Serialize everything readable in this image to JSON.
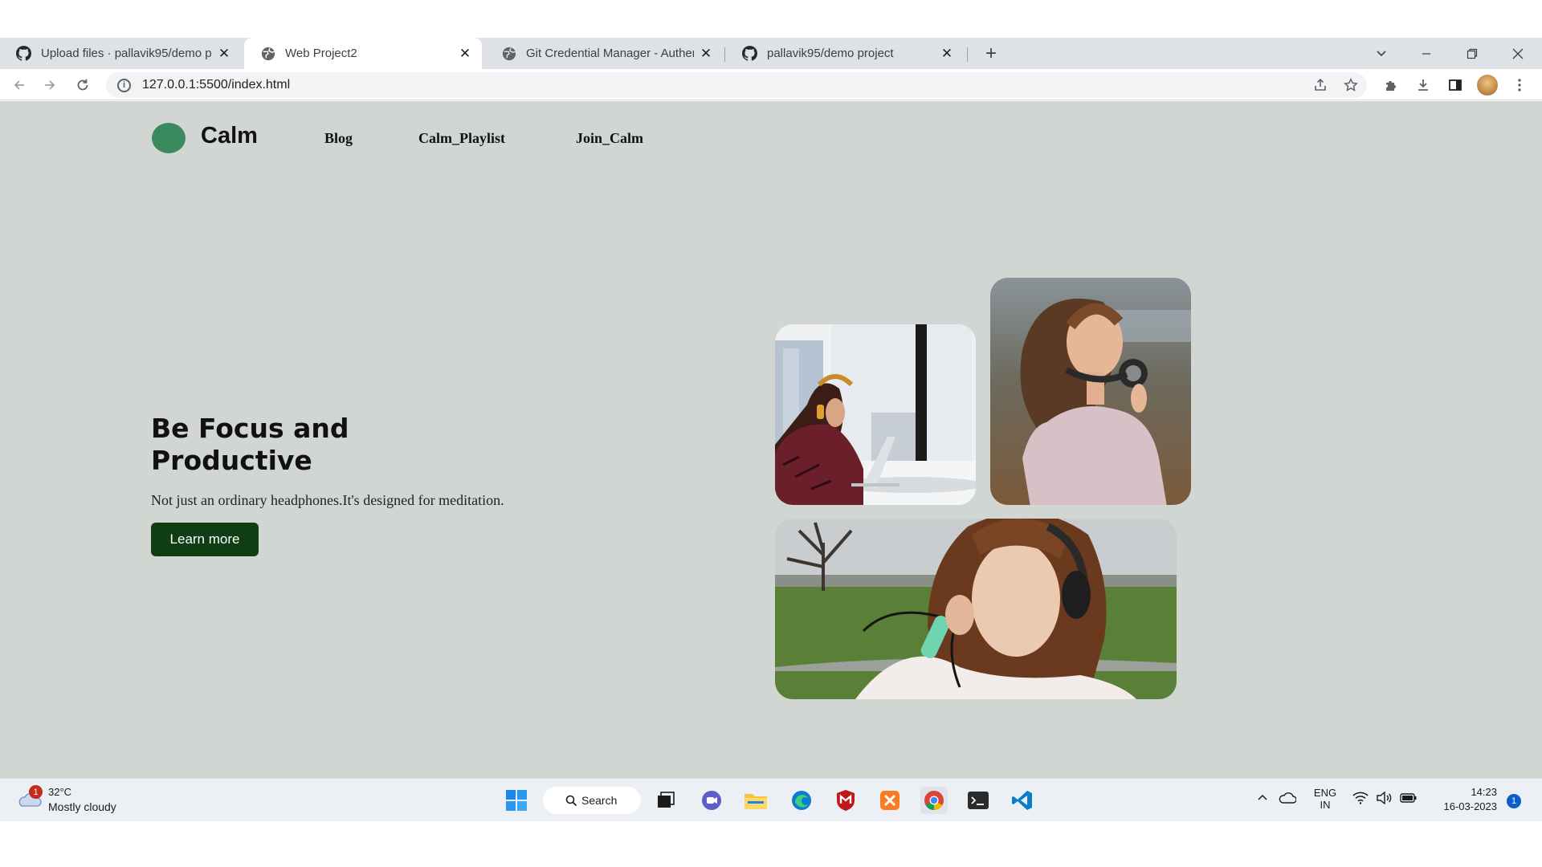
{
  "browser": {
    "tabs": [
      {
        "title": "Upload files · pallavik95/demo pr",
        "icon": "github-icon",
        "active": false
      },
      {
        "title": "Web Project2",
        "icon": "globe-icon",
        "active": true
      },
      {
        "title": "Git Credential Manager - Authen",
        "icon": "globe-icon",
        "active": false
      },
      {
        "title": "pallavik95/demo project",
        "icon": "github-icon",
        "active": false
      }
    ],
    "close_glyph": "✕",
    "new_tab_glyph": "+",
    "url": "127.0.0.1:5500/index.html"
  },
  "site": {
    "logo_text": "Calm",
    "logo_color": "#3a8a5d",
    "nav": [
      "Blog",
      "Calm_Playlist",
      "Join_Calm"
    ],
    "hero_title": "Be Focus and Productive",
    "hero_subtitle": "Not just an ordinary headphones.It's designed for meditation.",
    "cta_label": "Learn more",
    "cta_color": "#0f3d14",
    "background": "#d1d6d3"
  },
  "taskbar": {
    "weather_badge": "1",
    "temperature": "32°C",
    "condition": "Mostly cloudy",
    "search_label": "Search",
    "language": "ENG",
    "region": "IN",
    "time": "14:23",
    "date": "16-03-2023",
    "notification_count": "1"
  }
}
